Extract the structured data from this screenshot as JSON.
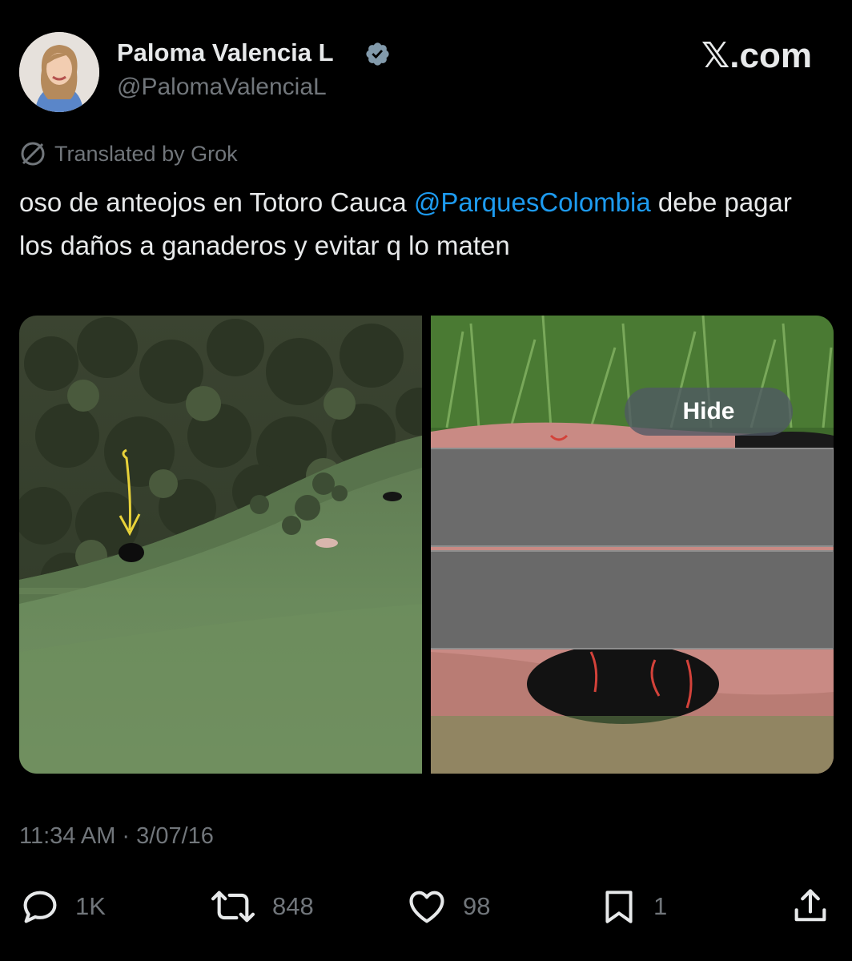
{
  "author": {
    "display_name": "Paloma Valencia L",
    "handle": "@PalomaValenciaL"
  },
  "brand": {
    "site_label": "𝕏.com"
  },
  "translation": {
    "label": "Translated by Grok"
  },
  "tweet": {
    "text_part1": "oso de anteojos en Totoro Cauca ",
    "mention": "@ParquesColombia",
    "text_part2": " debe pagar los daños a ganaderos y evitar q lo maten",
    "timestamp": "11:34 AM · 3/07/16"
  },
  "media": {
    "hide_label": "Hide"
  },
  "actions": {
    "replies": "1K",
    "reposts": "848",
    "likes": "98",
    "bookmarks": "1"
  },
  "colors": {
    "background": "#000000",
    "text_primary": "#e7e9ea",
    "text_secondary": "#71767b",
    "link": "#1d9bf0",
    "verified_badge": "#829aab"
  }
}
